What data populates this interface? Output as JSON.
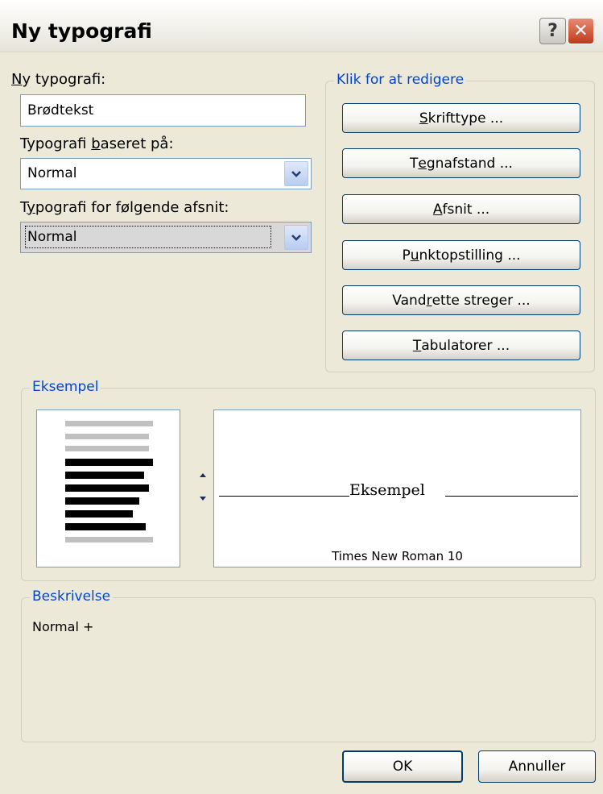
{
  "window": {
    "title": "Ny typografi",
    "help_glyph": "?",
    "close_glyph": "✕"
  },
  "form": {
    "name_label": {
      "pre": "",
      "mnemonic": "N",
      "post": "y typografi:"
    },
    "name_value": "Brødtekst",
    "based_on_label": {
      "pre": "Typografi ",
      "mnemonic": "b",
      "post": "aseret på:"
    },
    "based_on_value": "Normal",
    "following_label": {
      "pre": "T",
      "mnemonic": "y",
      "post": "pografi for følgende afsnit:"
    },
    "following_value": "Normal"
  },
  "edit_group": {
    "legend": "Klik for at redigere",
    "buttons": [
      {
        "pre": "",
        "mnemonic": "S",
        "post": "krifttype ..."
      },
      {
        "pre": "T",
        "mnemonic": "e",
        "post": "gnafstand ..."
      },
      {
        "pre": "",
        "mnemonic": "A",
        "post": "fsnit ..."
      },
      {
        "pre": "P",
        "mnemonic": "u",
        "post": "nktopstilling ..."
      },
      {
        "pre": "Vand",
        "mnemonic": "r",
        "post": "ette streger ..."
      },
      {
        "pre": "",
        "mnemonic": "T",
        "post": "abulatorer ..."
      }
    ]
  },
  "example_group": {
    "legend": "Eksempel",
    "sample_word": "Eksempel",
    "font_caption": "Times New Roman 10"
  },
  "description_group": {
    "legend": "Beskrivelse",
    "text": "Normal +"
  },
  "footer": {
    "ok_label": "OK",
    "cancel_label": "Annuller"
  },
  "colors": {
    "legend_blue": "#0046d5",
    "dialog_bg": "#ece9d8",
    "close_red": "#c0391a"
  }
}
